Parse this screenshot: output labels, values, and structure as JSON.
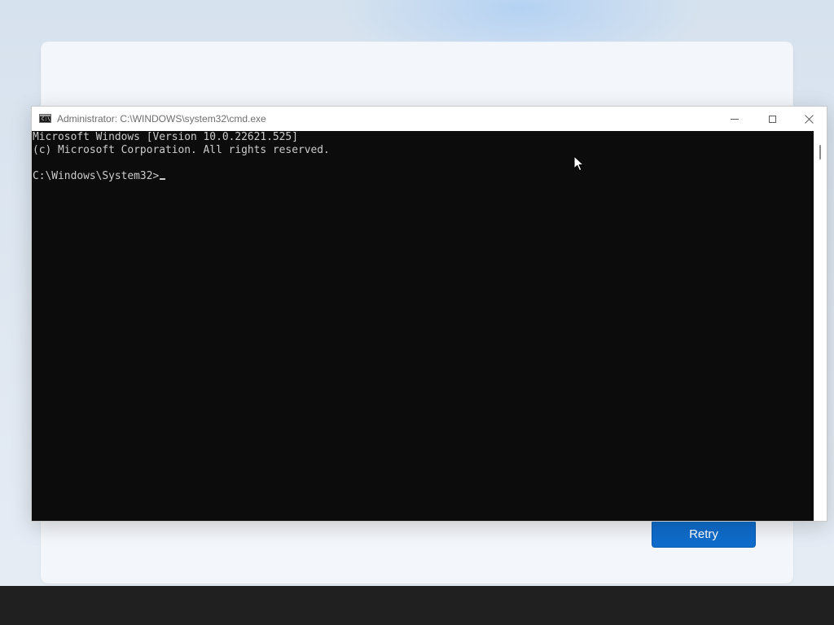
{
  "window": {
    "title": "Administrator: C:\\WINDOWS\\system32\\cmd.exe",
    "icon": "cmd-icon",
    "controls": [
      "minimize-icon",
      "maximize-icon",
      "close-icon"
    ]
  },
  "console": {
    "lines": [
      "Microsoft Windows [Version 10.0.22621.525]",
      "(c) Microsoft Corporation. All rights reserved.",
      "C:\\Windows\\System32>"
    ],
    "background_color": "#0c0c0c",
    "text_color": "#cccccc"
  },
  "setup": {
    "retry_label": "Retry",
    "accent_color": "#0f6ccb"
  },
  "taskbar": {
    "color": "#202020"
  }
}
